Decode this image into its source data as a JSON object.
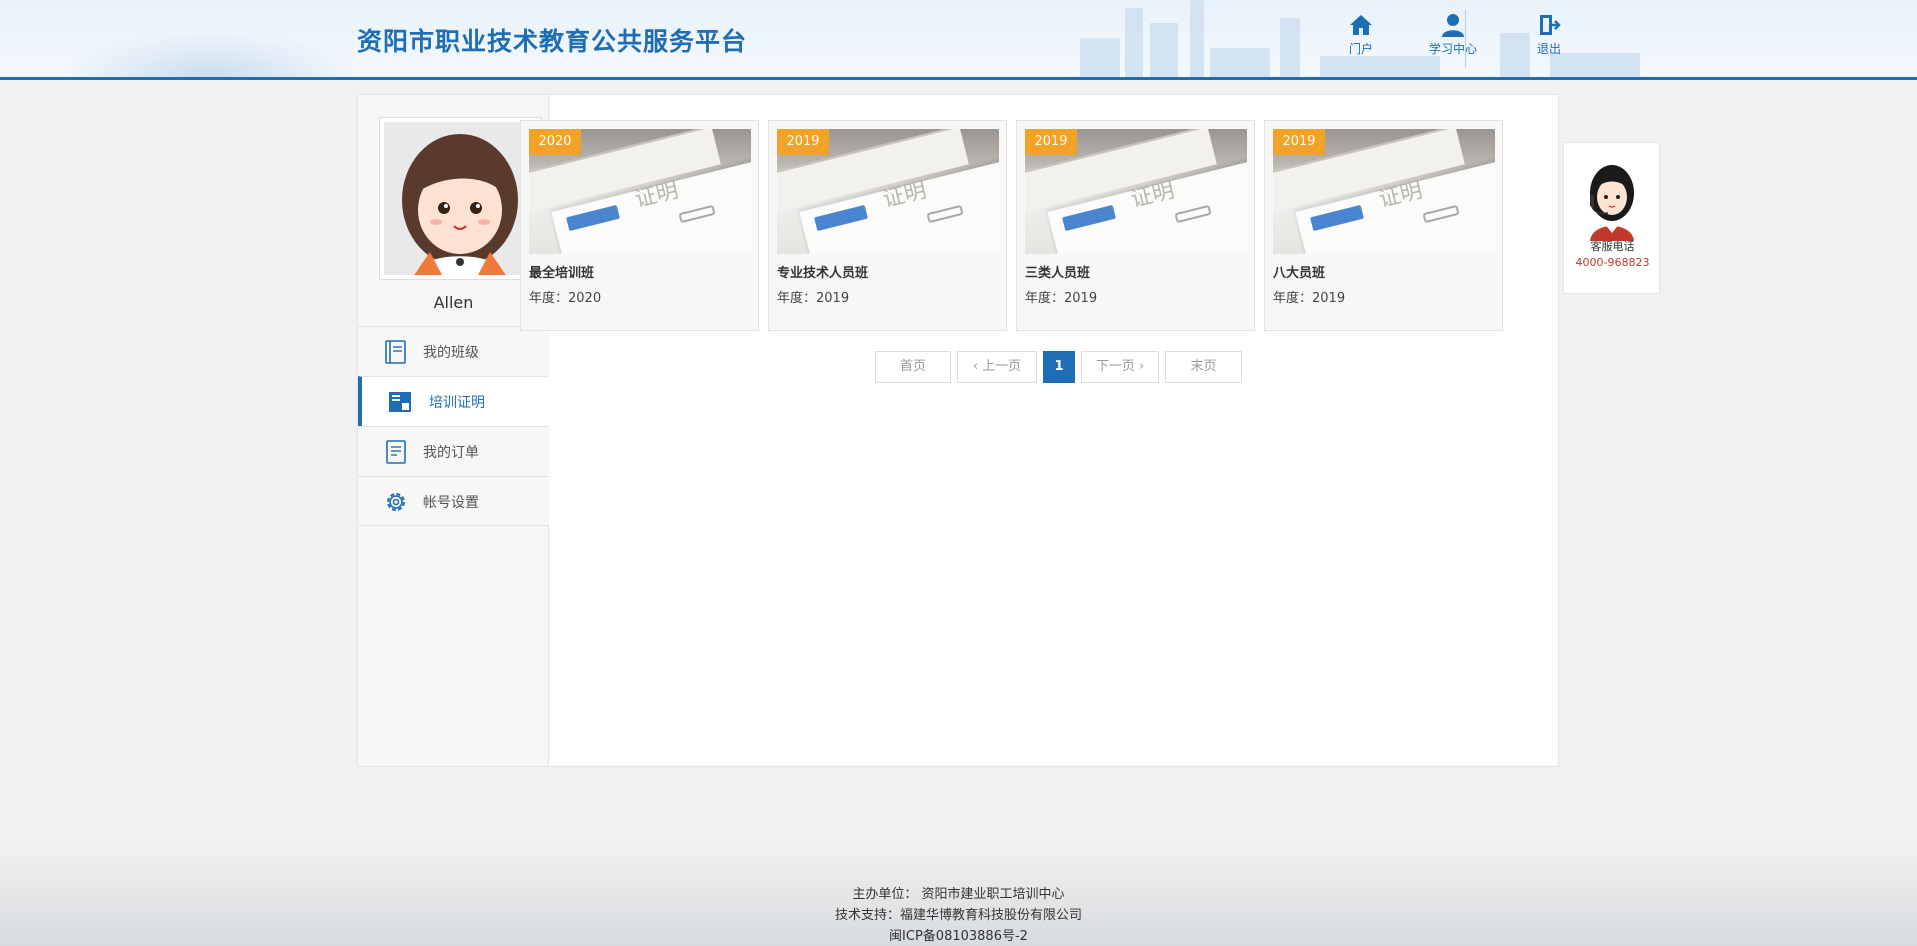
{
  "header": {
    "site_title": "资阳市职业技术教育公共服务平台",
    "nav": [
      {
        "label": "门户",
        "icon": "home-icon"
      },
      {
        "label": "学习中心",
        "icon": "user-icon"
      },
      {
        "label": "退出",
        "icon": "logout-icon"
      }
    ]
  },
  "sidebar": {
    "username": "Allen",
    "menu": [
      {
        "label": "我的班级",
        "icon": "book-icon",
        "active": false
      },
      {
        "label": "培训证明",
        "icon": "certificate-icon",
        "active": true
      },
      {
        "label": "我的订单",
        "icon": "order-icon",
        "active": false
      },
      {
        "label": "帐号设置",
        "icon": "gear-icon",
        "active": false
      }
    ]
  },
  "cards": [
    {
      "year_badge": "2020",
      "title": "最全培训班",
      "year_text": "年度：2020",
      "image_text": "证明"
    },
    {
      "year_badge": "2019",
      "title": "专业技术人员班",
      "year_text": "年度：2019",
      "image_text": "证明"
    },
    {
      "year_badge": "2019",
      "title": "三类人员班",
      "year_text": "年度：2019",
      "image_text": "证明"
    },
    {
      "year_badge": "2019",
      "title": "八大员班",
      "year_text": "年度：2019",
      "image_text": "证明"
    }
  ],
  "pagination": {
    "first": "首页",
    "prev": "上一页",
    "current": "1",
    "next": "下一页",
    "last": "末页"
  },
  "service": {
    "label": "客服电话",
    "phone": "4000-968823"
  },
  "footer": {
    "line1": "主办单位： 资阳市建业职工培训中心",
    "line2": "技术支持：福建华博教育科技股份有限公司",
    "line3": "闽ICP备08103886号-2"
  },
  "colors": {
    "brand": "#1f6db3",
    "badge": "#f0a326",
    "phone": "#c0392b"
  }
}
